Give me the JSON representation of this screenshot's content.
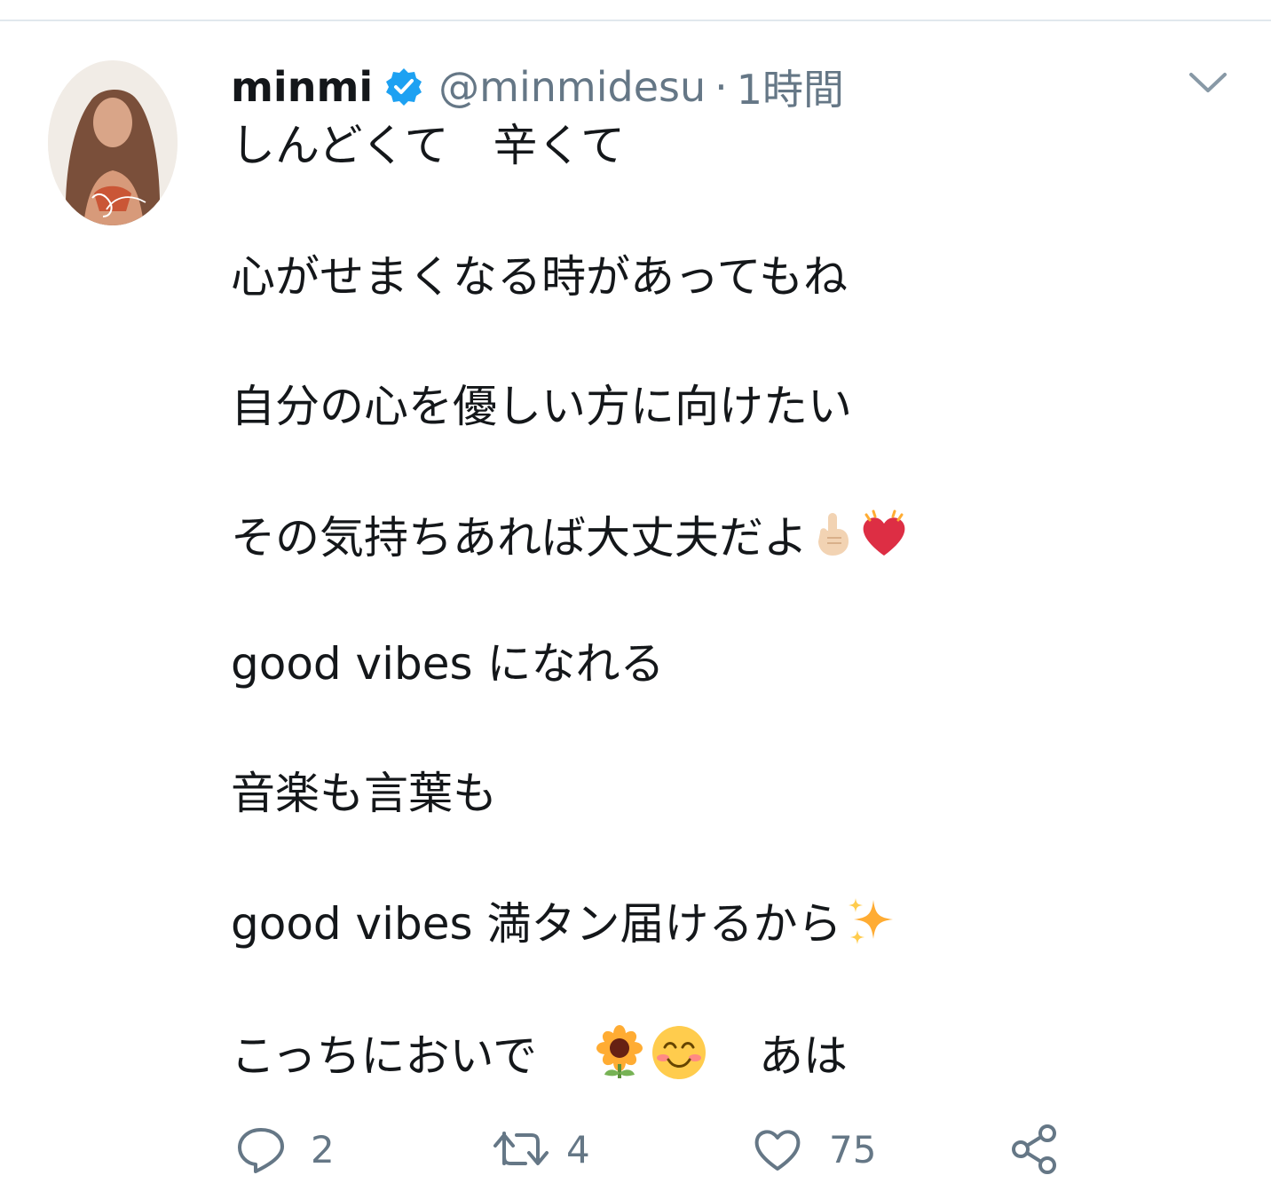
{
  "tweet": {
    "author_name": "minmi",
    "handle": "@minmidesu",
    "separator": "·",
    "time": "1時間",
    "lines": [
      "しんどくて　辛くて",
      "心がせまくなる時があってもね",
      "自分の心を優しい方に向けたい",
      "その気持ちあれば大丈夫だよ",
      "good vibes になれる",
      "音楽も言葉も",
      "good vibes 満タン届けるから",
      "こっちにおいで",
      "あは"
    ],
    "icons": {
      "verified": "verified-badge-icon",
      "more": "chevron-down-icon",
      "pointing": "index-pointing-up-emoji",
      "heart": "beating-heart-emoji",
      "sparkles": "sparkles-emoji",
      "sunflower": "sunflower-emoji",
      "smile": "smiling-face-emoji"
    },
    "actions": {
      "reply_count": "2",
      "retweet_count": "4",
      "like_count": "75"
    }
  },
  "colors": {
    "text": "#14171a",
    "secondary": "#657786",
    "verified": "#1da1f2",
    "divider": "#e1e8ed"
  }
}
